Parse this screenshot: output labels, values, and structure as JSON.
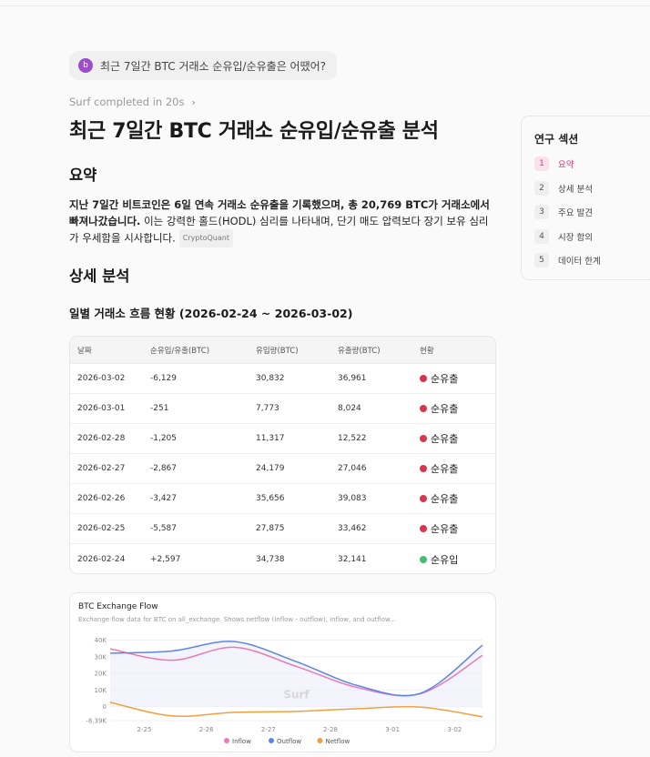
{
  "query": {
    "avatar": "b",
    "text": "최근 7일간 BTC 거래소 순유입/순유출은 어땠어?"
  },
  "status": {
    "text": "Surf completed in 20s",
    "chevron": "›"
  },
  "title": "최근 7일간 BTC 거래소 순유입/순유출 분석",
  "sections": {
    "summary_heading": "요약",
    "summary_bold": "지난 7일간 비트코인은 6일 연속 거래소 순유출을 기록했으며, 총 20,769 BTC가 거래소에서 빠져나갔습니다.",
    "summary_rest": " 이는 강력한 홀드(HODL) 심리를 나타내며, 단기 매도 압력보다 장기 보유 심리가 우세함을 시사합니다.",
    "summary_source": "CryptoQuant",
    "detail_heading": "상세 분석",
    "table_heading": "일별 거래소 흐름 현황 (2026-02-24 ~ 2026-03-02)"
  },
  "table": {
    "headers": [
      "날짜",
      "순유입/유출(BTC)",
      "유입량(BTC)",
      "유출량(BTC)",
      "현황"
    ],
    "rows": [
      {
        "date": "2026-03-02",
        "net": "-6,129",
        "in": "30,832",
        "out": "36,961",
        "status": "순유출",
        "color": "#d9354f"
      },
      {
        "date": "2026-03-01",
        "net": "-251",
        "in": "7,773",
        "out": "8,024",
        "status": "순유출",
        "color": "#d9354f"
      },
      {
        "date": "2026-02-28",
        "net": "-1,205",
        "in": "11,317",
        "out": "12,522",
        "status": "순유출",
        "color": "#d9354f"
      },
      {
        "date": "2026-02-27",
        "net": "-2,867",
        "in": "24,179",
        "out": "27,046",
        "status": "순유출",
        "color": "#d9354f"
      },
      {
        "date": "2026-02-26",
        "net": "-3,427",
        "in": "35,656",
        "out": "39,083",
        "status": "순유출",
        "color": "#d9354f"
      },
      {
        "date": "2026-02-25",
        "net": "-5,587",
        "in": "27,875",
        "out": "33,462",
        "status": "순유출",
        "color": "#d9354f"
      },
      {
        "date": "2026-02-24",
        "net": "+2,597",
        "in": "34,738",
        "out": "32,141",
        "status": "순유입",
        "color": "#3fbf72"
      }
    ]
  },
  "toc": {
    "title": "연구 섹션",
    "items": [
      {
        "num": "1",
        "label": "요약"
      },
      {
        "num": "2",
        "label": "상세 분석"
      },
      {
        "num": "3",
        "label": "주요 발견"
      },
      {
        "num": "4",
        "label": "시장 함의"
      },
      {
        "num": "5",
        "label": "데이터 한계"
      }
    ]
  },
  "chart_data": {
    "type": "line",
    "title": "BTC Exchange Flow",
    "subtitle": "Exchange flow data for BTC on all_exchange. Shows netflow (inflow - outflow), inflow, and outflow...",
    "watermark": "Surf",
    "x": [
      "2026-02-24",
      "2026-02-25",
      "2026-02-26",
      "2026-02-27",
      "2026-02-28",
      "2026-03-01",
      "2026-03-02"
    ],
    "x_ticks": [
      "2-25",
      "2-26",
      "2-27",
      "2-28",
      "3-01",
      "3-02"
    ],
    "y_ticks": [
      "40K",
      "30K",
      "20K",
      "10K",
      "0",
      "-8.39K"
    ],
    "y_tick_values": [
      40000,
      30000,
      20000,
      10000,
      0,
      -8390
    ],
    "ylim": [
      -8390,
      43000
    ],
    "series": [
      {
        "name": "Inflow",
        "color": "#e87bb6",
        "values": [
          34738,
          27875,
          35656,
          24179,
          11317,
          7773,
          30832
        ]
      },
      {
        "name": "Outflow",
        "color": "#5b86e5",
        "values": [
          32141,
          33462,
          39083,
          27046,
          12522,
          8024,
          36961
        ]
      },
      {
        "name": "Netflow",
        "color": "#f0a040",
        "values": [
          2597,
          -5587,
          -3427,
          -2867,
          -1205,
          -251,
          -6129
        ]
      }
    ]
  }
}
